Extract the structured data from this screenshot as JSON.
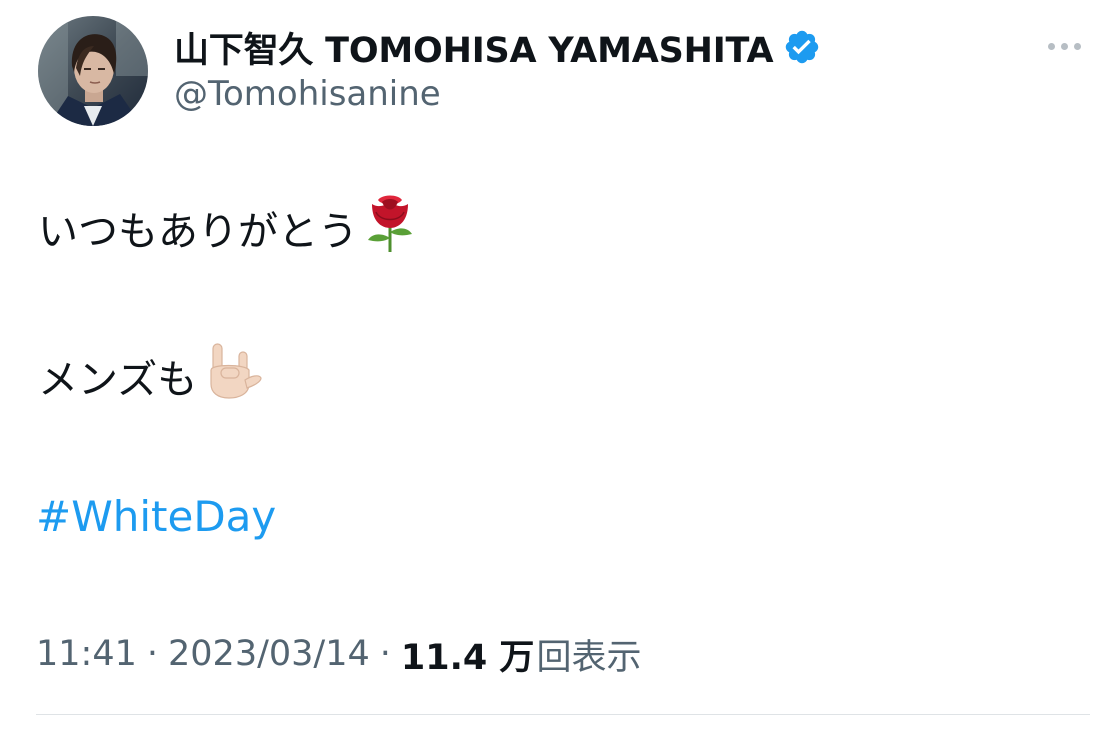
{
  "author": {
    "display_name": "山下智久 TOMOHISA YAMASHITA",
    "handle": "@Tomohisanine",
    "verified": true
  },
  "colors": {
    "accent": "#1d9bf0",
    "text_primary": "#0f1419",
    "text_secondary": "#536471"
  },
  "icons": {
    "verified": "verified-badge-icon",
    "more": "more-options-icon",
    "rose": "rose-emoji",
    "hand": "love-you-gesture-emoji"
  },
  "tweet": {
    "line_1": "いつもありがとう",
    "line_2": "メンズも",
    "hashtag": "#WhiteDay"
  },
  "meta": {
    "time": "11:41",
    "separator": "·",
    "date": "2023/03/14",
    "views_count": "11.4 万",
    "views_label": "回表示"
  }
}
